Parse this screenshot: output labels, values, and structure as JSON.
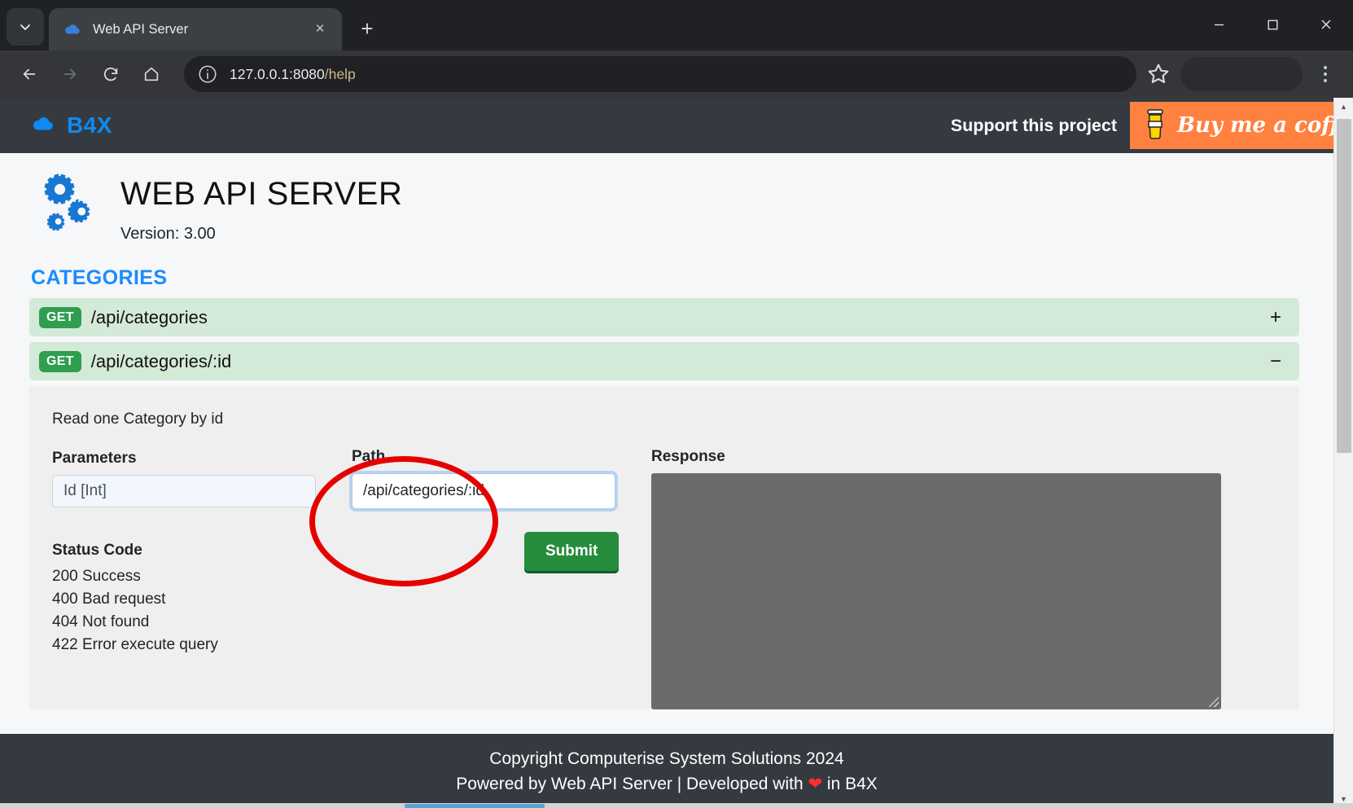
{
  "browser": {
    "tab": {
      "title": "Web API Server",
      "favicon": "cloud-icon"
    },
    "tablist_btn": "tab-search-icon",
    "new_tab": "+",
    "close_tab": "×",
    "nav": {
      "back": "back-arrow-icon",
      "forward": "forward-arrow-icon",
      "reload": "reload-icon",
      "home": "home-icon"
    },
    "omnibox": {
      "site_info_icon": "info-circle-icon",
      "url_scheme_host": "127.0.0.1:8080",
      "url_path": "/help",
      "full_url": "127.0.0.1:8080/help",
      "bookmark_icon": "star-icon"
    },
    "menu_icon": "kebab-menu-icon",
    "window": {
      "minimize": "–",
      "maximize": "☐",
      "close": "✕"
    }
  },
  "site": {
    "navbar": {
      "brand": "B4X",
      "brand_icon": "cloud-icon",
      "brand_color": "#0d8bf2",
      "support_text": "Support this project",
      "coffee_button": {
        "label": "Buy me a coffee",
        "icon": "coffee-cup-icon",
        "color": "#ff813f"
      },
      "background": "#343a40"
    },
    "hero": {
      "icon": "gears-icon",
      "title": "WEB API SERVER",
      "version": "Version: 3.00"
    },
    "section": {
      "title": "CATEGORIES",
      "color": "#1a8cff"
    },
    "endpoints": [
      {
        "method": "GET",
        "path": "/api/categories",
        "toggle": "+",
        "expanded": false
      },
      {
        "method": "GET",
        "path": "/api/categories/:id",
        "toggle": "−",
        "expanded": true
      }
    ],
    "detail": {
      "description": "Read one Category by id",
      "parameters_label": "Parameters",
      "parameters_value": "Id [Int]",
      "path_label": "Path",
      "path_value": "/api/categories/:id",
      "submit_label": "Submit",
      "response_label": "Response",
      "response_value": "",
      "status_code_label": "Status Code",
      "status_codes": [
        "200 Success",
        "400 Bad request",
        "404 Not found",
        "422 Error execute query"
      ]
    },
    "footer": {
      "line1": "Copyright Computerise System Solutions 2024",
      "line2_a": "Powered by Web API Server | Developed with ",
      "line2_heart": "❤",
      "line2_b": " in B4X"
    }
  },
  "annotation": {
    "shape": "ellipse",
    "color": "#e60000",
    "target": "path-input"
  },
  "scrollbar": {
    "up": "▲",
    "down": "▼"
  }
}
